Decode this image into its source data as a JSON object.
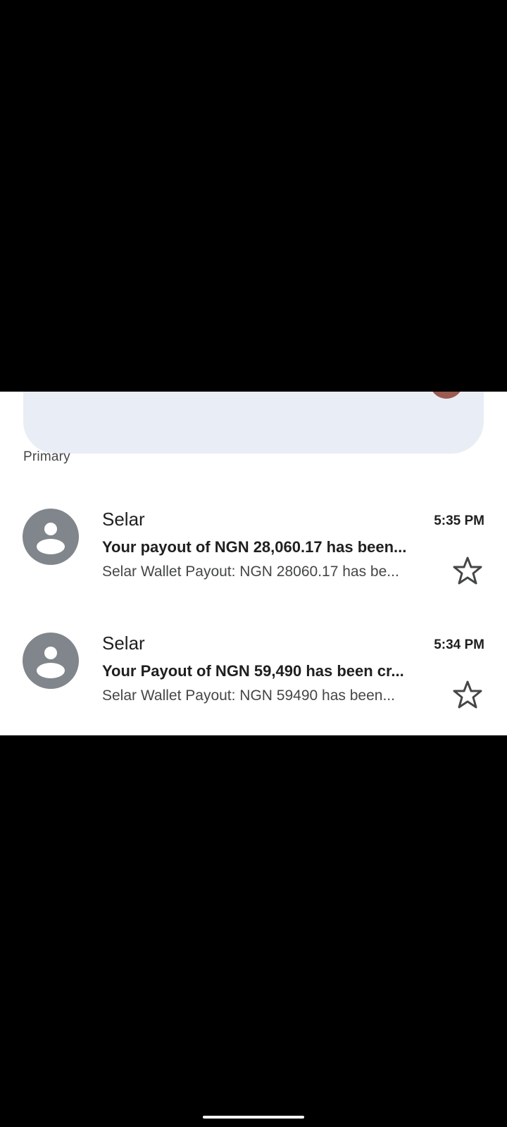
{
  "inbox": {
    "section_label": "Primary",
    "emails": [
      {
        "sender": "Selar",
        "time": "5:35 PM",
        "subject": "Your payout of NGN 28,060.17 has been...",
        "snippet": "Selar Wallet Payout: NGN 28060.17 has be...",
        "starred": false,
        "avatar_icon": "person-icon"
      },
      {
        "sender": "Selar",
        "time": "5:34 PM",
        "subject": "Your Payout of NGN 59,490 has been cr...",
        "snippet": "Selar Wallet Payout: NGN 59490 has been...",
        "starred": false,
        "avatar_icon": "person-icon"
      }
    ]
  },
  "colors": {
    "background": "#000000",
    "panel": "#ffffff",
    "search_bar": "#e9edf6",
    "avatar": "#80868b",
    "text_primary": "#1f1f1f",
    "text_secondary": "#444746"
  }
}
